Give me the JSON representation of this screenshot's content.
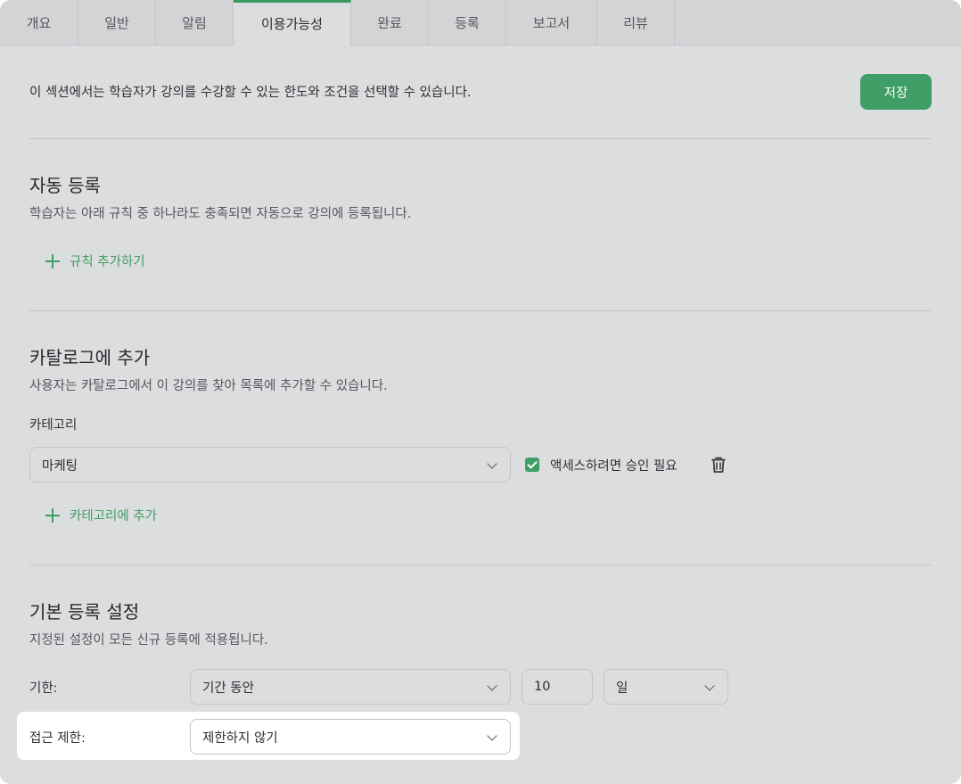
{
  "tabs": [
    {
      "label": "개요",
      "active": false
    },
    {
      "label": "일반",
      "active": false
    },
    {
      "label": "알림",
      "active": false
    },
    {
      "label": "이용가능성",
      "active": true
    },
    {
      "label": "완료",
      "active": false
    },
    {
      "label": "등록",
      "active": false
    },
    {
      "label": "보고서",
      "active": false
    },
    {
      "label": "리뷰",
      "active": false
    }
  ],
  "intro_text": "이 섹션에서는 학습자가 강의를 수강할 수 있는 한도와 조건을 선택할 수 있습니다.",
  "save_label": "저장",
  "auto_enroll": {
    "title": "자동 등록",
    "description": "학습자는 아래 규칙 중 하나라도 충족되면 자동으로 강의에 등록됩니다.",
    "add_rule_label": "규칙 추가하기"
  },
  "catalog": {
    "title": "카탈로그에 추가",
    "description": "사용자는 카탈로그에서 이 강의를 찾아 목록에 추가할 수 있습니다.",
    "category_label": "카테고리",
    "category_value": "마케팅",
    "approval_label": "액세스하려면 승인 필요",
    "approval_checked": true,
    "add_category_label": "카테고리에 추가"
  },
  "default_enroll": {
    "title": "기본 등록 설정",
    "description": "지정된 설정이 모든 신규 등록에 적용됩니다.",
    "deadline_label": "기한:",
    "deadline_mode": "기간 동안",
    "deadline_amount": "10",
    "deadline_unit": "일",
    "access_label": "접근 제한:",
    "access_value": "제한하지 않기"
  },
  "colors": {
    "accent": "#3f9e66",
    "background": "#dcdddf",
    "highlight": "#ffffff"
  }
}
